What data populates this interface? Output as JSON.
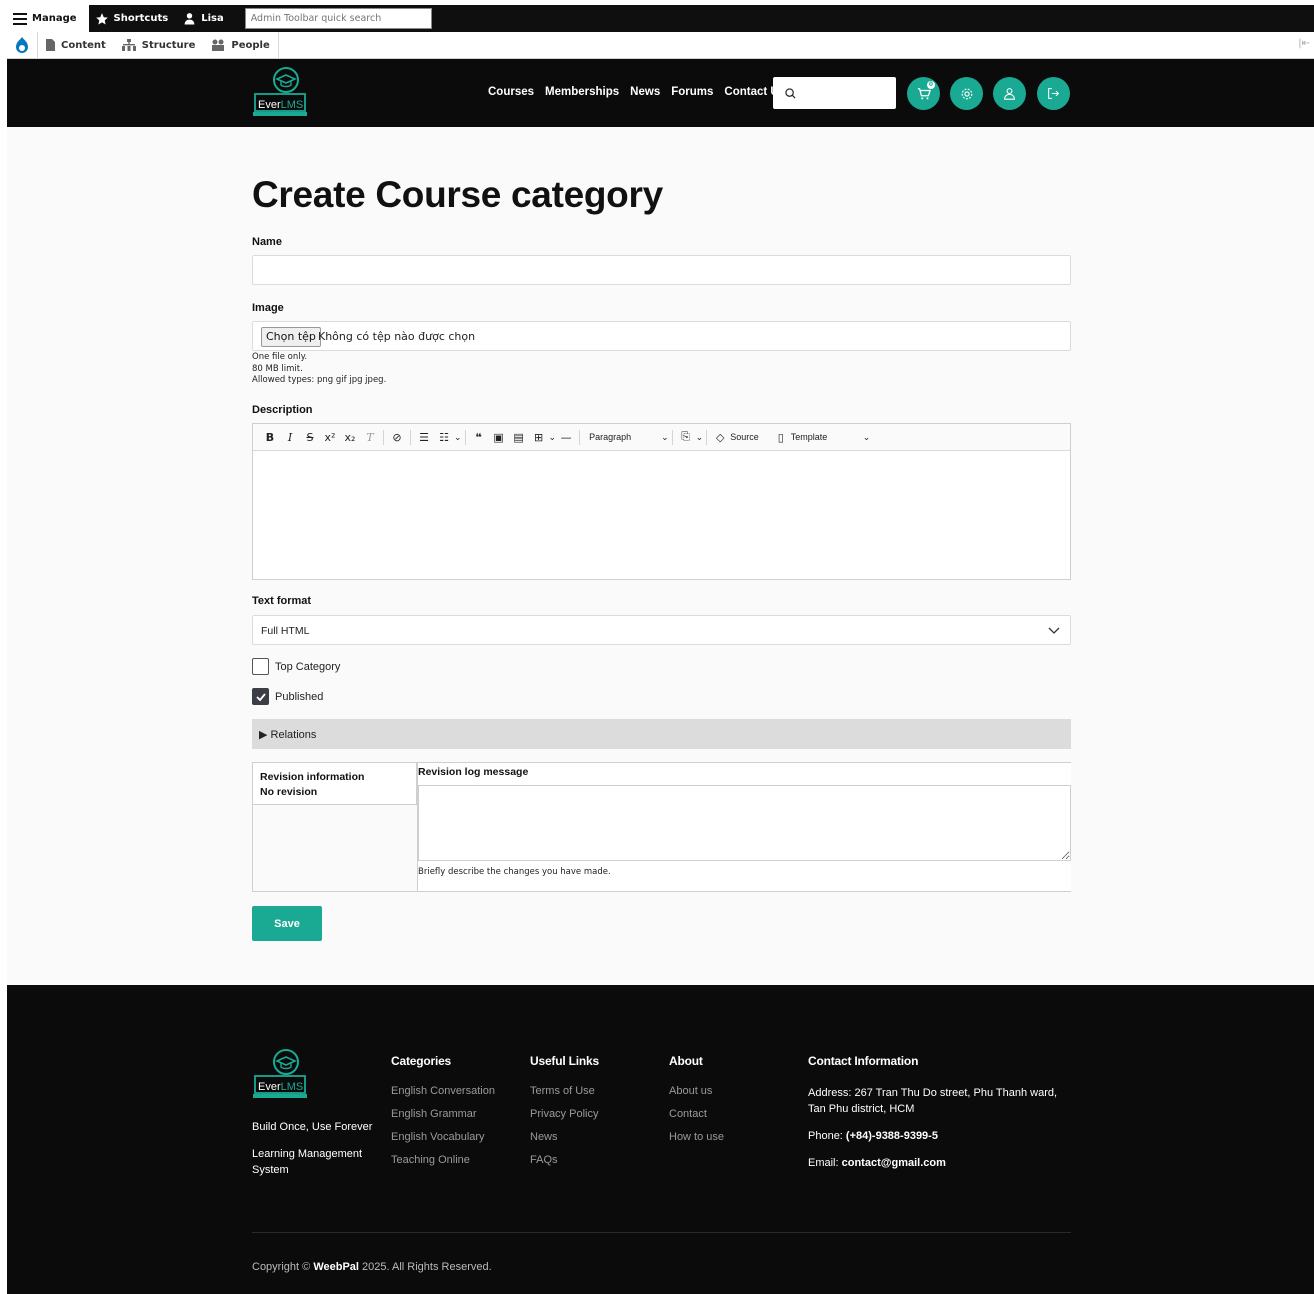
{
  "toolbar": {
    "manage": "Manage",
    "shortcuts": "Shortcuts",
    "user": "Lisa",
    "search_placeholder": "Admin Toolbar quick search",
    "content": "Content",
    "structure": "Structure",
    "people": "People"
  },
  "header": {
    "logo_text_a": "Ever",
    "logo_text_b": "LMS",
    "nav": [
      "Courses",
      "Memberships",
      "News",
      "Forums",
      "Contact Us"
    ],
    "cart_count": "0"
  },
  "form": {
    "title": "Create Course category",
    "name_label": "Name",
    "image_label": "Image",
    "file_button": "Chọn tệp",
    "file_status": "Không có tệp nào được chọn",
    "file_help": [
      "One file only.",
      "80 MB limit.",
      "Allowed types: png gif jpg jpeg."
    ],
    "description_label": "Description",
    "editor_paragraph": "Paragraph",
    "editor_source": "Source",
    "editor_template": "Template",
    "text_format_label": "Text format",
    "text_format_value": "Full HTML",
    "top_category_label": "Top Category",
    "published_label": "Published",
    "published_checked": true,
    "top_category_checked": false,
    "relations_label": "Relations",
    "revision_tab_title": "Revision information",
    "revision_tab_sub": "No revision",
    "revision_log_label": "Revision log message",
    "revision_help": "Briefly describe the changes you have made.",
    "save_label": "Save"
  },
  "footer": {
    "tagline1": "Build Once, Use Forever",
    "tagline2a": "Learning Management",
    "tagline2b": "System",
    "categories_title": "Categories",
    "categories": [
      "English Conversation",
      "English Grammar",
      "English Vocabulary",
      "Teaching Online"
    ],
    "useful_title": "Useful Links",
    "useful": [
      "Terms of Use",
      "Privacy Policy",
      "News",
      "FAQs"
    ],
    "about_title": "About",
    "about": [
      "About us",
      "Contact",
      "How to use"
    ],
    "contact_title": "Contact Information",
    "address_a": "Address: 267 Tran Thu Do street, Phu Thanh ward,",
    "address_b": "Tan Phu district, HCM",
    "phone_label": "Phone: ",
    "phone": "(+84)-9388-9399-5",
    "email_label": "Email: ",
    "email": "contact@gmail.com",
    "copyright_pre": "Copyright ©",
    "copyright_brand": "WeebPal",
    "copyright_post": " 2025. All Rights Reserved."
  },
  "colors": {
    "accent": "#1aa993",
    "dark": "#0b0b0b"
  }
}
